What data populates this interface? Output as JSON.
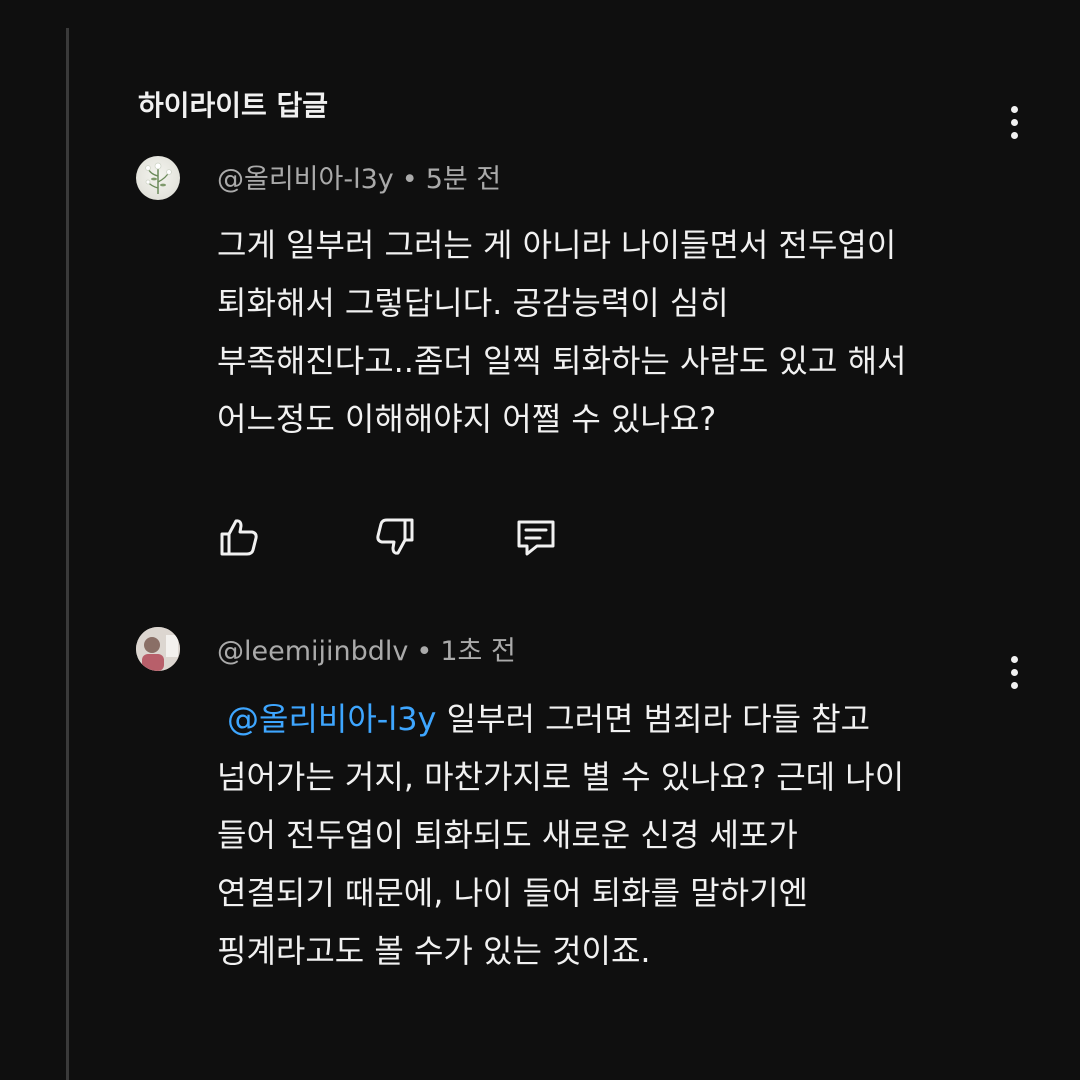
{
  "section": {
    "title": "하이라이트 답글"
  },
  "comments": [
    {
      "author": "@올리비아-l3y",
      "separator": "•",
      "time": "5분 전",
      "lines": [
        "그게 일부러 그러는 게 아니라 나이들면서 전두엽이",
        "퇴화해서 그렇답니다. 공감능력이 심히",
        "부족해진다고..좀더 일찍 퇴화하는 사람도 있고 해서",
        "어느정도 이해해야지 어쩔 수 있나요?"
      ],
      "actions": {
        "like_icon": "thumbs-up-icon",
        "dislike_icon": "thumbs-down-icon",
        "reply_icon": "comment-reply-icon"
      }
    },
    {
      "author": "@leemijinbdlv",
      "separator": "•",
      "time": "1초 전",
      "mention": "@올리비아-l3y",
      "lines": [
        " 일부러 그러면 범죄라 다들 참고",
        "넘어가는 거지, 마찬가지로 별 수 있나요? 근데 나이",
        "들어 전두엽이 퇴화되도 새로운 신경 세포가",
        "연결되기 때문에, 나이 들어 퇴화를 말하기엔",
        "핑계라고도 볼 수가 있는 것이죠."
      ]
    }
  ],
  "colors": {
    "background": "#0f0f0f",
    "text": "#f1f1f1",
    "meta": "#aaaaaa",
    "mention": "#3ea6ff"
  }
}
